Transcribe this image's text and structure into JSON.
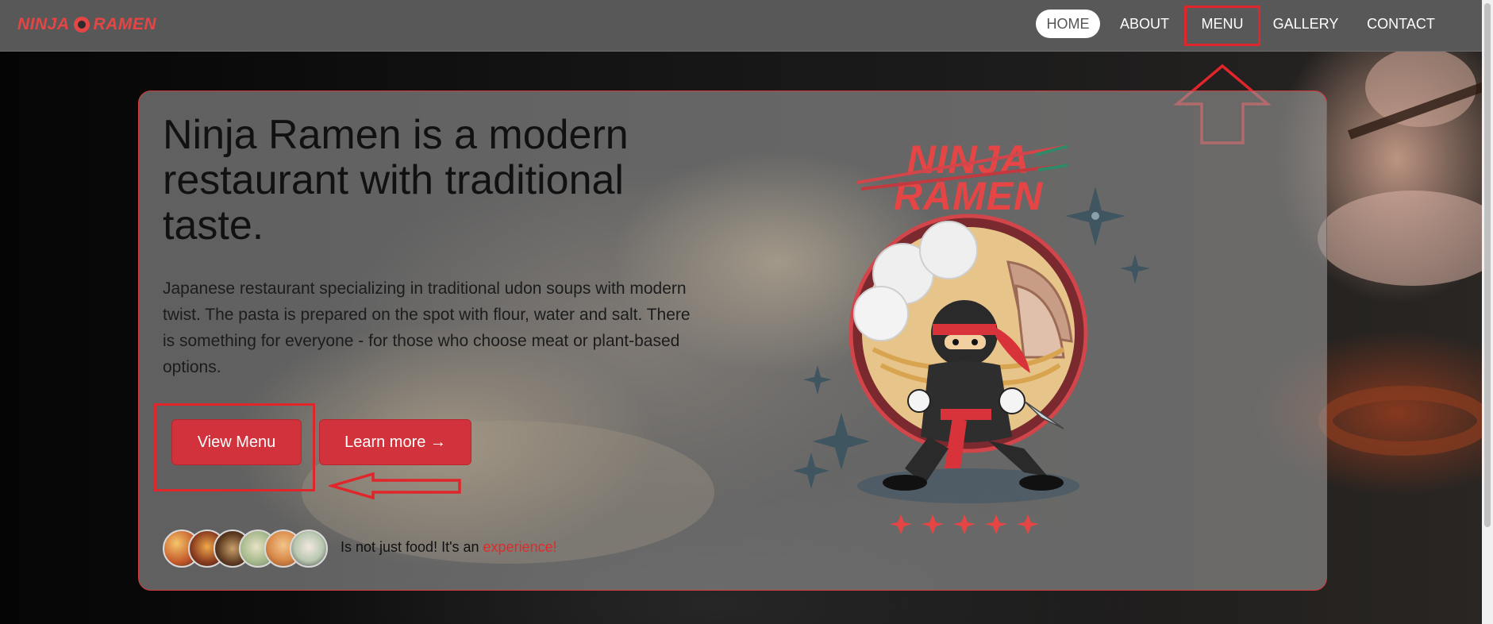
{
  "brand": {
    "part1": "NINJA",
    "part2": "RAMEN"
  },
  "nav": {
    "items": [
      {
        "label": "HOME",
        "active": true
      },
      {
        "label": "ABOUT",
        "active": false
      },
      {
        "label": "MENU",
        "active": false
      },
      {
        "label": "GALLERY",
        "active": false
      },
      {
        "label": "CONTACT",
        "active": false
      }
    ]
  },
  "hero": {
    "headline": "Ninja Ramen is a modern restaurant with traditional taste.",
    "description": "Japanese restaurant specializing in traditional udon soups with modern twist. The pasta is prepared on the spot with flour, water and salt. There is something for everyone - for those who choose meat or plant-based options.",
    "view_menu_label": "View Menu",
    "learn_more_label": "Learn more →",
    "tagline_text": "Is not just food! It's an ",
    "tagline_accent": "experience!",
    "avatar_count": 6
  },
  "illustration": {
    "logo_line1": "NINJA",
    "logo_line2": "RAMEN"
  },
  "colors": {
    "accent": "#d1323b",
    "brand_red": "#e64545",
    "annotation": "#e0252b",
    "navbar_bg": "#585858"
  }
}
